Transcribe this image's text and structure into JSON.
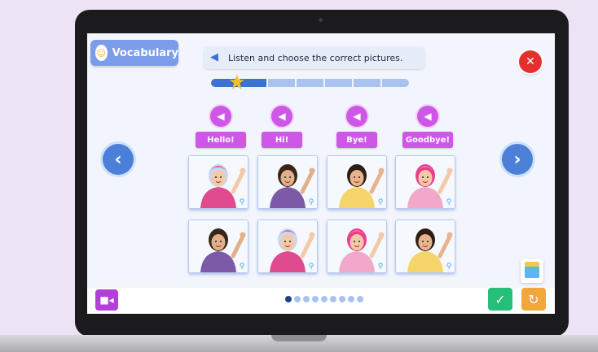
{
  "header": {
    "tag_label": "Vocabulary",
    "instruction": "Listen and choose the correct pictures.",
    "icons": {
      "tag": "smiley-icon",
      "instruction": "speaker-icon",
      "close": "close-icon"
    }
  },
  "progress": {
    "segments": 7,
    "completed": 2,
    "marker": "star-icon"
  },
  "words": [
    {
      "label": "Hello!"
    },
    {
      "label": "Hi!"
    },
    {
      "label": "Bye!"
    },
    {
      "label": "Goodbye!"
    }
  ],
  "navigation": {
    "prev_glyph": "‹",
    "next_glyph": "›"
  },
  "cards": {
    "row1": [
      "girl-pink-blue-hair",
      "boy-waving",
      "woman-yellow-top",
      "girl-pink-hair"
    ],
    "row2": [
      "boy-waving",
      "girl-pink-blue-hair",
      "girl-pink-hair",
      "woman-yellow-top"
    ]
  },
  "pagination": {
    "count": 9,
    "active": 0
  },
  "colors": {
    "accent_blue": "#4b7fd8",
    "word_purple": "#cf57e8",
    "close_red": "#e3302f",
    "check_green": "#24c07a",
    "reset_orange": "#f2a73a"
  }
}
